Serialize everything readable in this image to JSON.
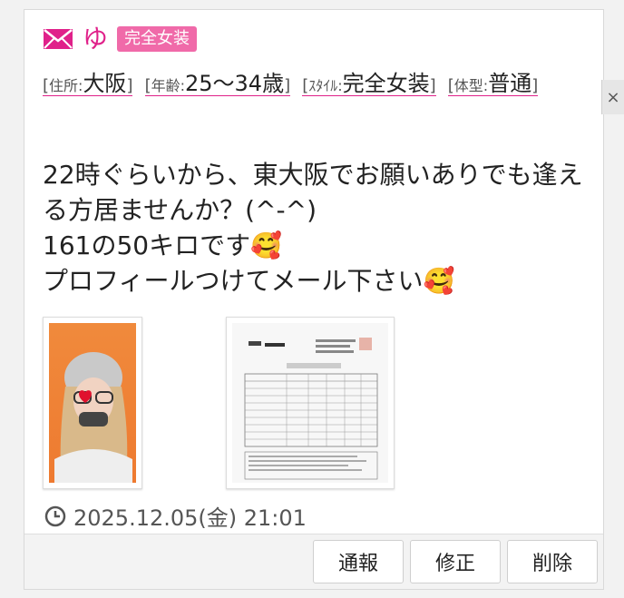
{
  "post": {
    "username": "ゆ",
    "badge": "完全女装",
    "attributes": [
      {
        "key": "住所:",
        "value": "大阪"
      },
      {
        "key": "年齢:",
        "value": "25〜34歳"
      },
      {
        "key": "ｽﾀｲﾙ:",
        "value": "完全女装"
      },
      {
        "key": "体型:",
        "value": "普通"
      }
    ],
    "message": "22時ぐらいから、東大阪でお願いありでも逢える方居ませんか？(^-^)\n161の50キロです🥰\nプロフィールつけてメール下さい🥰",
    "timestamp": "2025.12.05(金) 21:01"
  },
  "actions": {
    "report": "通報",
    "edit": "修正",
    "delete": "削除"
  },
  "close_label": "×",
  "colors": {
    "accent": "#e0218a",
    "badge_bg": "#f06aa9"
  },
  "icons": {
    "header": "mail-icon",
    "timestamp": "clock-icon",
    "close": "close-icon"
  }
}
